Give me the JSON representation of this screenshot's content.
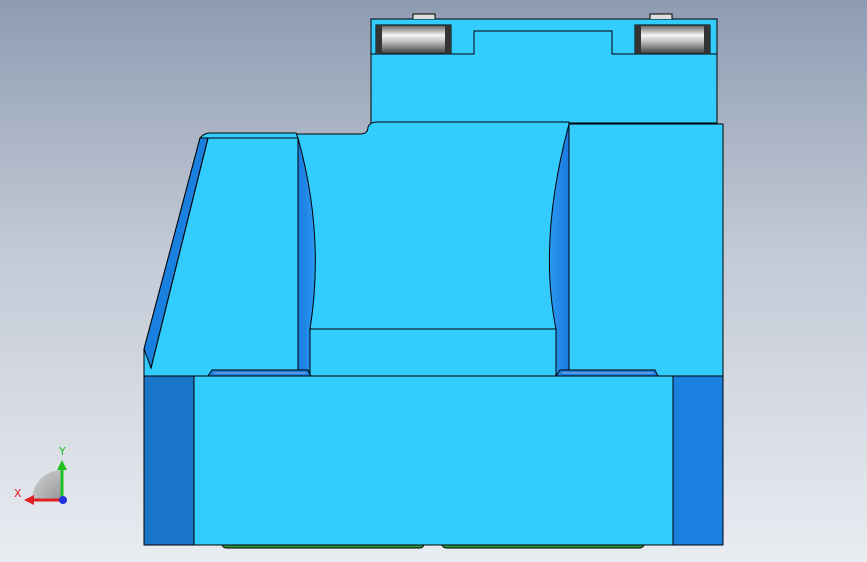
{
  "viewport": {
    "background": "graphics-area-gradient",
    "colors": {
      "body": "#33ccff",
      "body_shade": "#1a80e0",
      "body_dark": "#1a75c8",
      "edge": "#000000",
      "bearing": "#a8a8a8",
      "green_part": "#2f9a3a"
    }
  },
  "triad": {
    "x_label": "X",
    "y_label": "Y",
    "x_color": "#e02020",
    "y_color": "#20c020",
    "z_color": "#2030e0"
  }
}
